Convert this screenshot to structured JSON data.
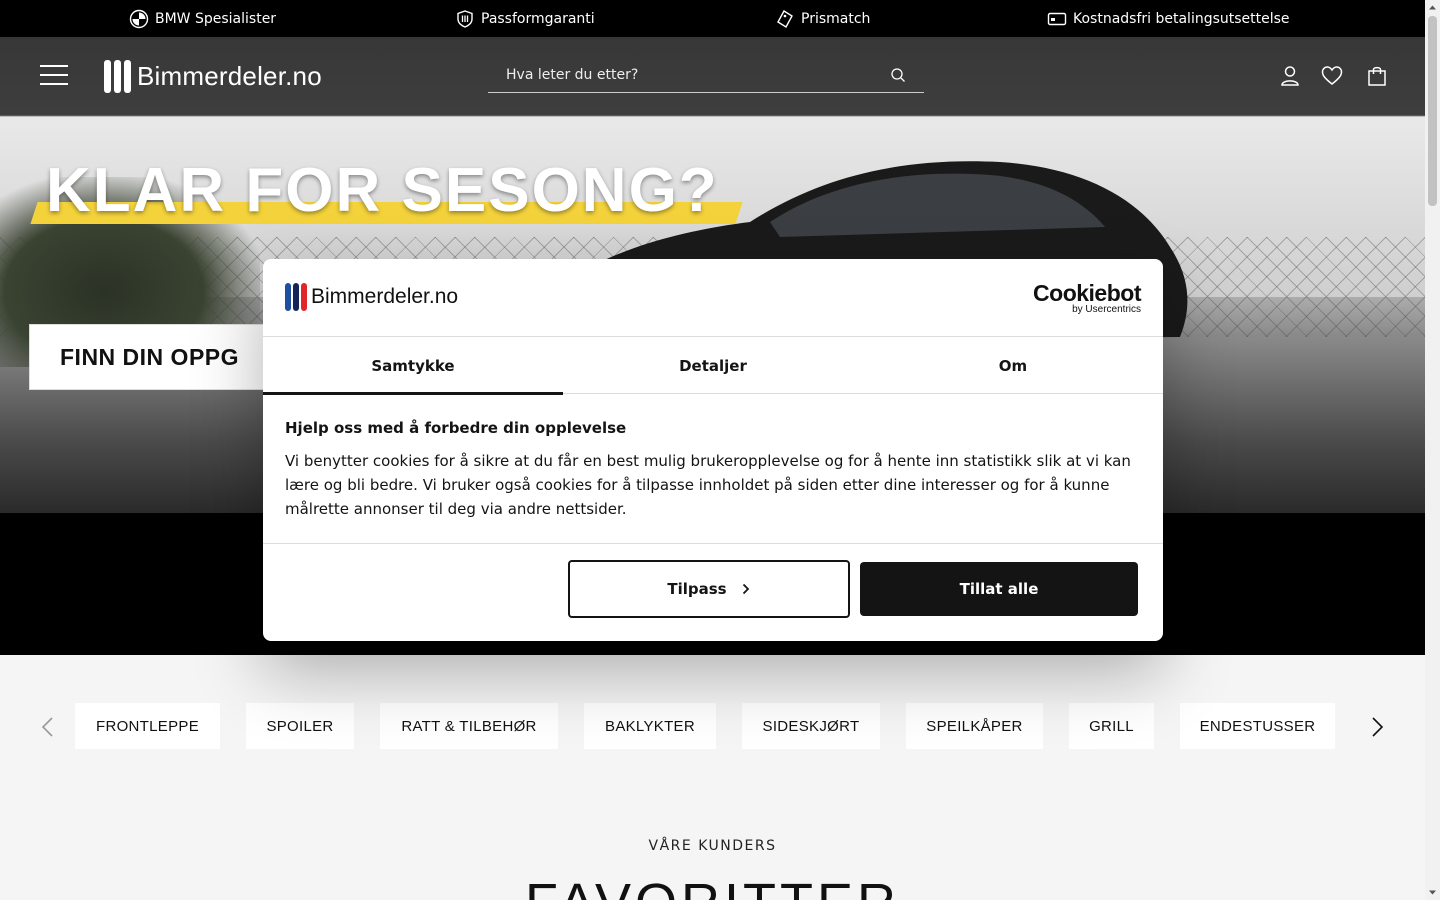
{
  "usp_bar": {
    "items": [
      {
        "label": "BMW Spesialister",
        "icon": "bmw-logo-icon"
      },
      {
        "label": "Passformgaranti",
        "icon": "shield-icon"
      },
      {
        "label": "Prismatch",
        "icon": "price-tag-icon"
      },
      {
        "label": "Kostnadsfri betalingsutsettelse",
        "icon": "credit-card-icon"
      }
    ]
  },
  "header": {
    "logo_text": "Bimmerdeler.no",
    "search_placeholder": "Hva leter du etter?",
    "icons": [
      "user-icon",
      "heart-icon",
      "shopping-bag-icon"
    ]
  },
  "hero": {
    "headline": "KLAR FOR SESONG?",
    "cta_label": "FINN DIN OPPG"
  },
  "categories": {
    "items": [
      "FRONTLEPPE",
      "SPOILER",
      "RATT & TILBEHØR",
      "BAKLYKTER",
      "SIDESKJØRT",
      "SPEILKÅPER",
      "GRILL",
      "ENDESTUSSER"
    ]
  },
  "section": {
    "overline": "VÅRE KUNDERS",
    "heading": "FAVORITTER"
  },
  "cookie_dialog": {
    "logo_text": "Bimmerdeler.no",
    "brand": "Cookiebot",
    "brand_sub": "by Usercentrics",
    "tabs": [
      "Samtykke",
      "Detaljer",
      "Om"
    ],
    "active_tab": "Samtykke",
    "title": "Hjelp oss med å forbedre din opplevelse",
    "body": "Vi benytter cookies for å sikre at du får en best mulig brukeropplevelse og for å hente inn statistikk slik at vi kan lære og bli bedre. Vi bruker også cookies for å tilpasse innholdet på siden etter dine interesser og for å kunne målrette annonser til deg via andre nettsider.",
    "customize_label": "Tilpass",
    "allow_all_label": "Tillat alle"
  },
  "colors": {
    "logo_blue": "#1e4fa0",
    "logo_navy": "#16245a",
    "logo_red": "#e0262b",
    "headline_accent": "#f3d23b",
    "dark": "#141414"
  }
}
